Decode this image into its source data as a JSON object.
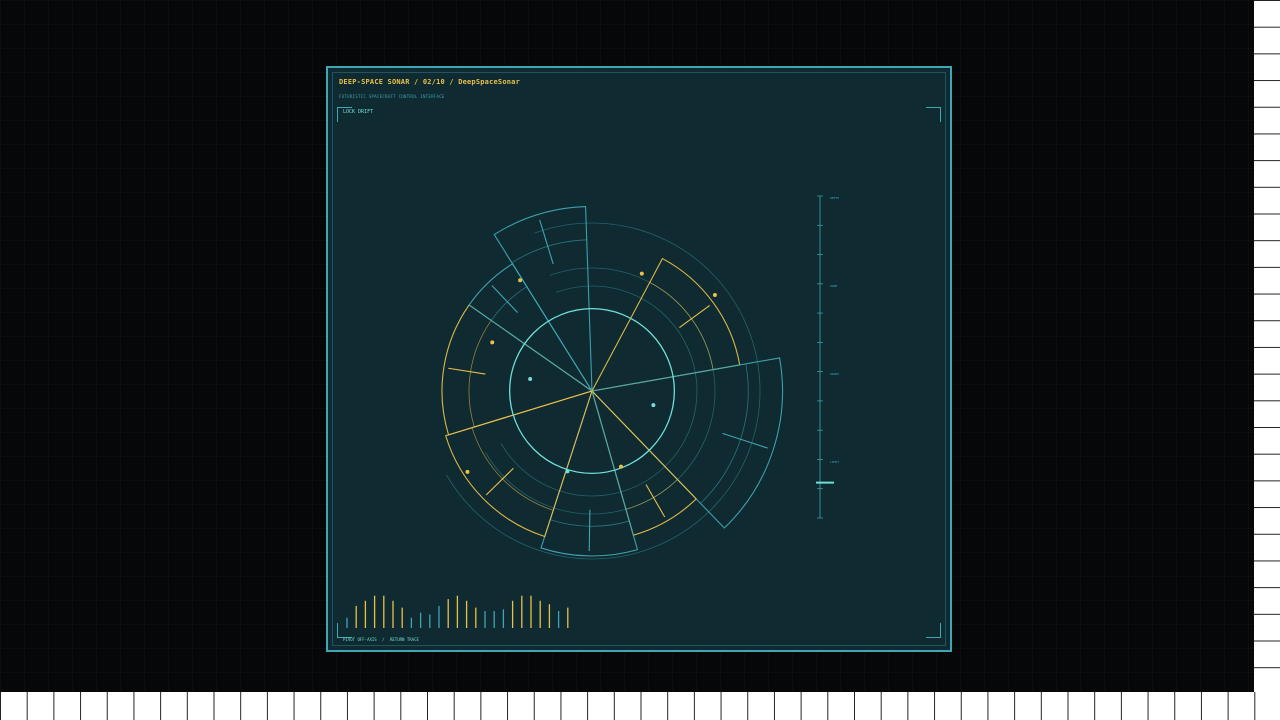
{
  "header": {
    "title": "DEEP-SPACE SONAR / 02/10 / DeepSpaceSonar",
    "subtitle": "FUTURISTIC SPACECRAFT CONTROL INTERFACE"
  },
  "controls": {
    "lock_drift_label": "LOCK DRIFT"
  },
  "footer": {
    "pivot_label": "PIVOT OFF-AXIS",
    "separator": "/",
    "return_label": "RETURN TRACE"
  },
  "depth_scale": {
    "labels": [
      "DEPTH",
      "ZONE",
      "RANGE",
      "LIMIT"
    ],
    "marker_level": 0.89
  },
  "colors": {
    "panel_bg": "#0f2a30",
    "cyan": "#3fa6b4",
    "bright_cyan": "#6fe0d8",
    "amber": "#e9c04a"
  },
  "radar": {
    "core_ring_radius": 0.45,
    "rings": [
      0.7,
      0.82,
      1.0
    ],
    "sectors": [
      {
        "start": 253,
        "end": 305,
        "outer": 1.0,
        "color": "amber"
      },
      {
        "start": 305,
        "end": 328,
        "outer": 1.0,
        "color": "cyan"
      },
      {
        "start": 328,
        "end": 358,
        "outer": 1.23,
        "color": "cyan"
      },
      {
        "start": 28,
        "end": 80,
        "outer": 1.0,
        "color": "amber"
      },
      {
        "start": 80,
        "end": 136,
        "outer": 1.27,
        "color": "cyan"
      },
      {
        "start": 136,
        "end": 164,
        "outer": 1.0,
        "color": "amber"
      },
      {
        "start": 164,
        "end": 198,
        "outer": 1.1,
        "color": "cyan"
      },
      {
        "start": 198,
        "end": 253,
        "outer": 1.02,
        "color": "amber"
      }
    ],
    "contacts": [
      {
        "bearing": 296,
        "range": 0.74,
        "color": "amber"
      },
      {
        "bearing": 327,
        "range": 0.88,
        "color": "amber"
      },
      {
        "bearing": 52,
        "range": 1.04,
        "color": "amber"
      },
      {
        "bearing": 23,
        "range": 0.85,
        "color": "amber"
      },
      {
        "bearing": 281,
        "range": 0.42,
        "color": "bright_cyan"
      },
      {
        "bearing": 103,
        "range": 0.42,
        "color": "bright_cyan"
      },
      {
        "bearing": 159,
        "range": 0.54,
        "color": "amber"
      },
      {
        "bearing": 197,
        "range": 0.56,
        "color": "bright_cyan"
      },
      {
        "bearing": 237,
        "range": 0.99,
        "color": "amber"
      }
    ]
  },
  "spectrum": {
    "levels": [
      0.3,
      0.65,
      0.8,
      0.95,
      0.95,
      0.8,
      0.6,
      0.3,
      0.45,
      0.4,
      0.65,
      0.85,
      0.95,
      0.8,
      0.6,
      0.5,
      0.5,
      0.55,
      0.8,
      0.95,
      0.95,
      0.8,
      0.7,
      0.5,
      0.6
    ],
    "colors": [
      "cyan",
      "amber",
      "amber",
      "amber",
      "amber",
      "amber",
      "amber",
      "cyan",
      "cyan",
      "cyan",
      "cyan",
      "amber",
      "amber",
      "amber",
      "amber",
      "cyan",
      "cyan",
      "cyan",
      "amber",
      "amber",
      "amber",
      "amber",
      "amber",
      "cyan",
      "amber"
    ]
  }
}
